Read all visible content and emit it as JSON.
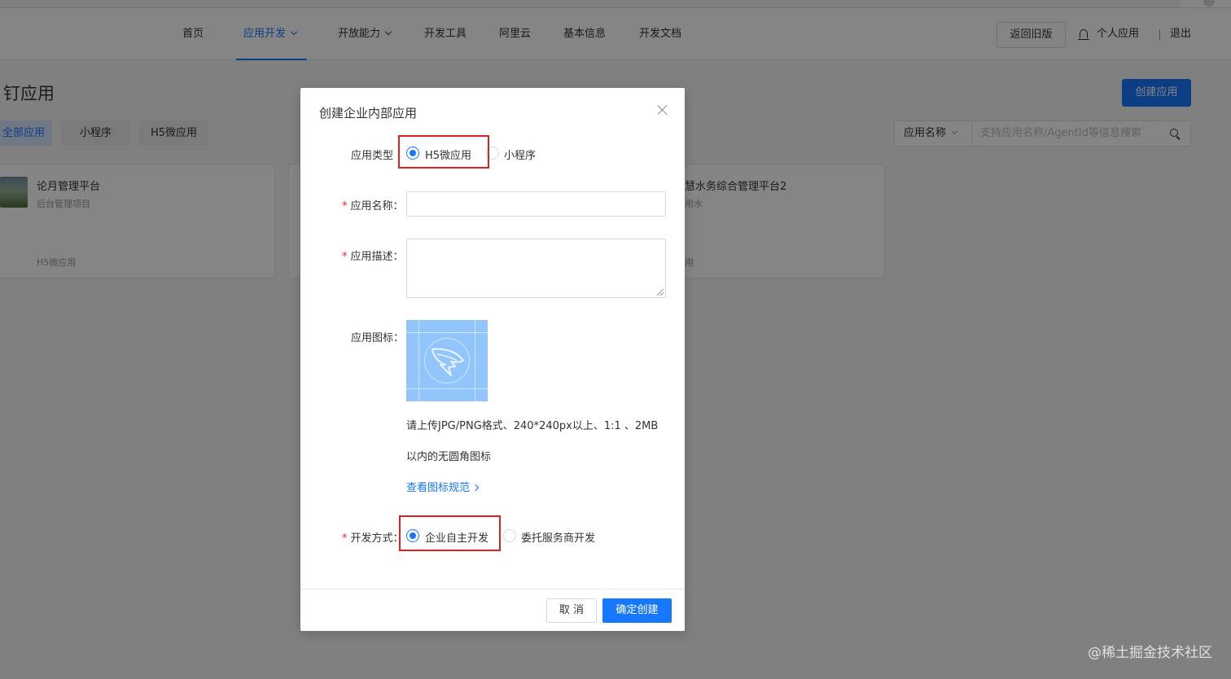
{
  "nav": {
    "items": [
      {
        "label": "首页",
        "active": false,
        "dropdown": false
      },
      {
        "label": "应用开发",
        "active": true,
        "dropdown": true
      },
      {
        "label": "开放能力",
        "active": false,
        "dropdown": true
      },
      {
        "label": "开发工具",
        "active": false,
        "dropdown": false
      },
      {
        "label": "阿里云",
        "active": false,
        "dropdown": false
      },
      {
        "label": "基本信息",
        "active": false,
        "dropdown": false
      },
      {
        "label": "开发文档",
        "active": false,
        "dropdown": false
      }
    ],
    "return_old": "返回旧版",
    "my_apps": "个人应用",
    "logout": "退出"
  },
  "page": {
    "title": "钉应用",
    "create_button": "创建应用",
    "tabs": [
      {
        "label": "全部应用",
        "active": true
      },
      {
        "label": "小程序",
        "active": false
      },
      {
        "label": "H5微应用",
        "active": false
      }
    ],
    "search": {
      "select_value": "应用名称",
      "placeholder": "支持应用名称/AgentId等信息搜索"
    },
    "cards": [
      {
        "name": "论月管理平台",
        "desc": "后台管理项目",
        "type": "H5微应用"
      },
      {
        "name": "",
        "desc": "",
        "type": ""
      },
      {
        "name": "慧水务综合管理平台2",
        "desc": "用水",
        "type": "用"
      }
    ]
  },
  "modal": {
    "title": "创建企业内部应用",
    "app_type": {
      "label": "应用类型",
      "options": [
        "H5微应用",
        "小程序"
      ],
      "selected": "H5微应用"
    },
    "app_name": {
      "label": "应用名称：",
      "required": true,
      "value": ""
    },
    "app_desc": {
      "label": "应用描述：",
      "required": true,
      "value": ""
    },
    "app_icon": {
      "label": "应用图标：",
      "hint_line1": "请上传JPG/PNG格式、240*240px以上、1:1 、2MB",
      "hint_line2": "以内的无圆角图标",
      "link": "查看图标规范"
    },
    "dev_mode": {
      "label": "开发方式：",
      "required": true,
      "options": [
        "企业自主开发",
        "委托服务商开发"
      ],
      "selected": "企业自主开发"
    },
    "cancel": "取 消",
    "confirm": "确定创建"
  },
  "watermark": "@稀土掘金技术社区",
  "colors": {
    "primary": "#1677ff",
    "highlight": "#e02020",
    "required": "#f5222d"
  }
}
